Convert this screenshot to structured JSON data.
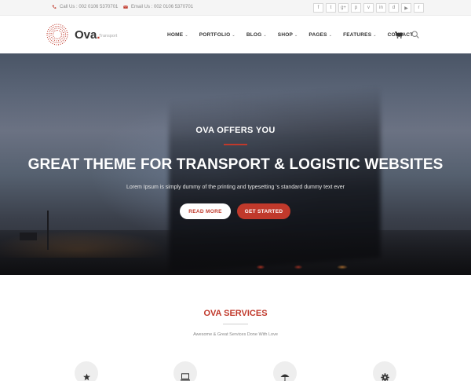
{
  "topbar": {
    "phone_text": "Call Us : 002 0106 5370701",
    "email_text": "Email Us : 002 0106 5370701",
    "social": [
      "facebook-icon",
      "twitter-icon",
      "google-plus-icon",
      "pinterest-icon",
      "vimeo-icon",
      "linkedin-icon",
      "dribbble-icon",
      "youtube-icon",
      "rss-icon"
    ],
    "social_glyphs": [
      "f",
      "t",
      "g+",
      "p",
      "v",
      "in",
      "d",
      "▶",
      "r"
    ]
  },
  "header": {
    "logo_text": "Ova",
    "logo_dot": ".",
    "logo_subtitle": "Transport",
    "nav": [
      {
        "label": "HOME",
        "dropdown": true
      },
      {
        "label": "PORTFOLIO",
        "dropdown": true
      },
      {
        "label": "BLOG",
        "dropdown": true
      },
      {
        "label": "SHOP",
        "dropdown": true
      },
      {
        "label": "PAGES",
        "dropdown": true
      },
      {
        "label": "FEATURES",
        "dropdown": true
      },
      {
        "label": "CONTACT",
        "dropdown": false
      }
    ],
    "chevron": "⌄"
  },
  "hero": {
    "eyebrow": "OVA OFFERS YOU",
    "title": "GREAT THEME FOR TRANSPORT & LOGISTIC WEBSITES",
    "description": "Lorem Ipsum is simply dummy of the printing and typesetting 's standard dummy text ever",
    "btn_more": "READ MORE",
    "btn_start": "GET STARTED"
  },
  "services": {
    "title": "OVA SERVICES",
    "subtitle": "Awesome & Great Services Done With Love",
    "icons": [
      "star-icon",
      "laptop-icon",
      "umbrella-icon",
      "gear-icon"
    ]
  },
  "colors": {
    "accent": "#c0392b",
    "topbar_bg": "#f5f5f5",
    "text": "#333333"
  }
}
